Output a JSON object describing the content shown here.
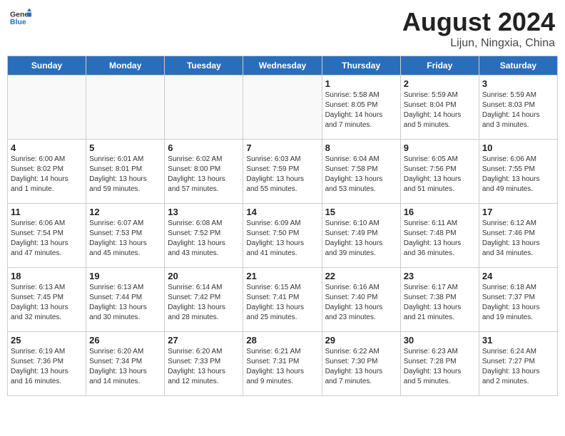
{
  "header": {
    "logo_general": "General",
    "logo_blue": "Blue",
    "month": "August 2024",
    "location": "Lijun, Ningxia, China"
  },
  "days_of_week": [
    "Sunday",
    "Monday",
    "Tuesday",
    "Wednesday",
    "Thursday",
    "Friday",
    "Saturday"
  ],
  "weeks": [
    [
      {
        "day": "",
        "info": ""
      },
      {
        "day": "",
        "info": ""
      },
      {
        "day": "",
        "info": ""
      },
      {
        "day": "",
        "info": ""
      },
      {
        "day": "1",
        "info": "Sunrise: 5:58 AM\nSunset: 8:05 PM\nDaylight: 14 hours\nand 7 minutes."
      },
      {
        "day": "2",
        "info": "Sunrise: 5:59 AM\nSunset: 8:04 PM\nDaylight: 14 hours\nand 5 minutes."
      },
      {
        "day": "3",
        "info": "Sunrise: 5:59 AM\nSunset: 8:03 PM\nDaylight: 14 hours\nand 3 minutes."
      }
    ],
    [
      {
        "day": "4",
        "info": "Sunrise: 6:00 AM\nSunset: 8:02 PM\nDaylight: 14 hours\nand 1 minute."
      },
      {
        "day": "5",
        "info": "Sunrise: 6:01 AM\nSunset: 8:01 PM\nDaylight: 13 hours\nand 59 minutes."
      },
      {
        "day": "6",
        "info": "Sunrise: 6:02 AM\nSunset: 8:00 PM\nDaylight: 13 hours\nand 57 minutes."
      },
      {
        "day": "7",
        "info": "Sunrise: 6:03 AM\nSunset: 7:59 PM\nDaylight: 13 hours\nand 55 minutes."
      },
      {
        "day": "8",
        "info": "Sunrise: 6:04 AM\nSunset: 7:58 PM\nDaylight: 13 hours\nand 53 minutes."
      },
      {
        "day": "9",
        "info": "Sunrise: 6:05 AM\nSunset: 7:56 PM\nDaylight: 13 hours\nand 51 minutes."
      },
      {
        "day": "10",
        "info": "Sunrise: 6:06 AM\nSunset: 7:55 PM\nDaylight: 13 hours\nand 49 minutes."
      }
    ],
    [
      {
        "day": "11",
        "info": "Sunrise: 6:06 AM\nSunset: 7:54 PM\nDaylight: 13 hours\nand 47 minutes."
      },
      {
        "day": "12",
        "info": "Sunrise: 6:07 AM\nSunset: 7:53 PM\nDaylight: 13 hours\nand 45 minutes."
      },
      {
        "day": "13",
        "info": "Sunrise: 6:08 AM\nSunset: 7:52 PM\nDaylight: 13 hours\nand 43 minutes."
      },
      {
        "day": "14",
        "info": "Sunrise: 6:09 AM\nSunset: 7:50 PM\nDaylight: 13 hours\nand 41 minutes."
      },
      {
        "day": "15",
        "info": "Sunrise: 6:10 AM\nSunset: 7:49 PM\nDaylight: 13 hours\nand 39 minutes."
      },
      {
        "day": "16",
        "info": "Sunrise: 6:11 AM\nSunset: 7:48 PM\nDaylight: 13 hours\nand 36 minutes."
      },
      {
        "day": "17",
        "info": "Sunrise: 6:12 AM\nSunset: 7:46 PM\nDaylight: 13 hours\nand 34 minutes."
      }
    ],
    [
      {
        "day": "18",
        "info": "Sunrise: 6:13 AM\nSunset: 7:45 PM\nDaylight: 13 hours\nand 32 minutes."
      },
      {
        "day": "19",
        "info": "Sunrise: 6:13 AM\nSunset: 7:44 PM\nDaylight: 13 hours\nand 30 minutes."
      },
      {
        "day": "20",
        "info": "Sunrise: 6:14 AM\nSunset: 7:42 PM\nDaylight: 13 hours\nand 28 minutes."
      },
      {
        "day": "21",
        "info": "Sunrise: 6:15 AM\nSunset: 7:41 PM\nDaylight: 13 hours\nand 25 minutes."
      },
      {
        "day": "22",
        "info": "Sunrise: 6:16 AM\nSunset: 7:40 PM\nDaylight: 13 hours\nand 23 minutes."
      },
      {
        "day": "23",
        "info": "Sunrise: 6:17 AM\nSunset: 7:38 PM\nDaylight: 13 hours\nand 21 minutes."
      },
      {
        "day": "24",
        "info": "Sunrise: 6:18 AM\nSunset: 7:37 PM\nDaylight: 13 hours\nand 19 minutes."
      }
    ],
    [
      {
        "day": "25",
        "info": "Sunrise: 6:19 AM\nSunset: 7:36 PM\nDaylight: 13 hours\nand 16 minutes."
      },
      {
        "day": "26",
        "info": "Sunrise: 6:20 AM\nSunset: 7:34 PM\nDaylight: 13 hours\nand 14 minutes."
      },
      {
        "day": "27",
        "info": "Sunrise: 6:20 AM\nSunset: 7:33 PM\nDaylight: 13 hours\nand 12 minutes."
      },
      {
        "day": "28",
        "info": "Sunrise: 6:21 AM\nSunset: 7:31 PM\nDaylight: 13 hours\nand 9 minutes."
      },
      {
        "day": "29",
        "info": "Sunrise: 6:22 AM\nSunset: 7:30 PM\nDaylight: 13 hours\nand 7 minutes."
      },
      {
        "day": "30",
        "info": "Sunrise: 6:23 AM\nSunset: 7:28 PM\nDaylight: 13 hours\nand 5 minutes."
      },
      {
        "day": "31",
        "info": "Sunrise: 6:24 AM\nSunset: 7:27 PM\nDaylight: 13 hours\nand 2 minutes."
      }
    ]
  ]
}
